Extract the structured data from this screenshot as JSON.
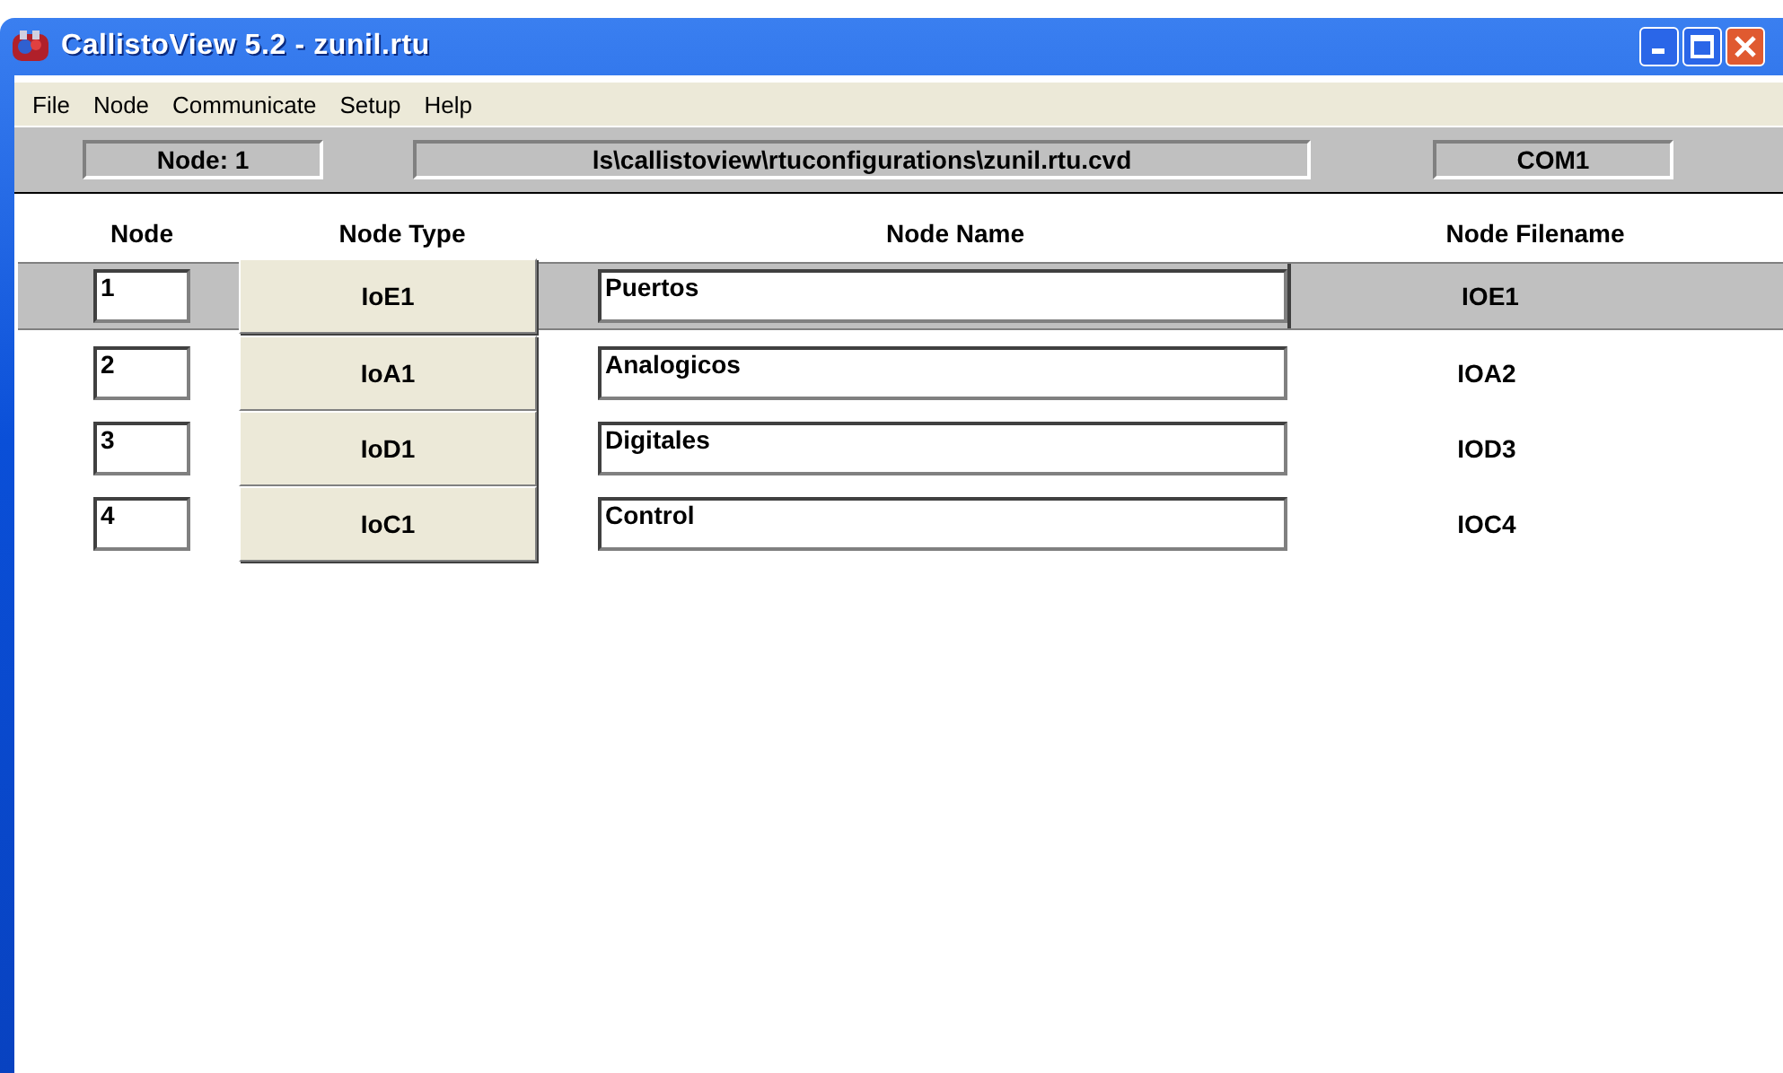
{
  "window": {
    "title": "CallistoView 5.2 - zunil.rtu"
  },
  "menu": [
    "File",
    "Node",
    "Communicate",
    "Setup",
    "Help"
  ],
  "status_bar": {
    "node": "Node: 1",
    "path": "ls\\callistoview\\rtuconfigurations\\zunil.rtu.cvd",
    "port": "COM1"
  },
  "table": {
    "columns": [
      "Node",
      "Node Type",
      "Node Name",
      "Node Filename"
    ],
    "rows": [
      {
        "node": "1",
        "type": "IoE1",
        "name": "Puertos",
        "filename": "IOE1",
        "selected": true
      },
      {
        "node": "2",
        "type": "IoA1",
        "name": "Analogicos",
        "filename": "IOA2",
        "selected": false
      },
      {
        "node": "3",
        "type": "IoD1",
        "name": "Digitales",
        "filename": "IOD3",
        "selected": false
      },
      {
        "node": "4",
        "type": "IoC1",
        "name": "Control",
        "filename": "IOC4",
        "selected": false
      }
    ]
  }
}
